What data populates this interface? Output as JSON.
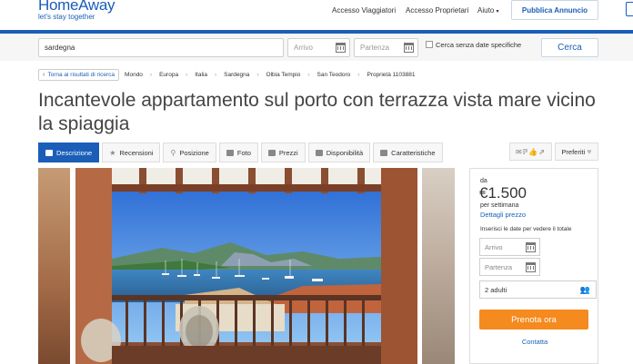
{
  "header": {
    "logo_text": "HomeAway",
    "logo_tagline": "let's stay together",
    "nav": {
      "travelers": "Accesso Viaggiatori",
      "owners": "Accesso Proprietari",
      "help": "Aiuto"
    },
    "publish_button": "Pubblica Annuncio"
  },
  "search": {
    "destination_value": "sardegna",
    "arrival_placeholder": "Arrivo",
    "departure_placeholder": "Partenza",
    "no_dates_label": "Cerca senza date specifiche",
    "search_button": "Cerca"
  },
  "breadcrumb": {
    "back_label": "Torna ai risultati di ricerca",
    "items": [
      "Mondo",
      "Europa",
      "Italia",
      "Sardegna",
      "Olbia Tempio",
      "San Teodoro",
      "Proprietà 1103881"
    ]
  },
  "listing": {
    "title": "Incantevole appartamento sul porto con terrazza vista mare vicino la spiaggia"
  },
  "tabs": [
    {
      "label": "Descrizione",
      "active": true
    },
    {
      "label": "Recensioni",
      "active": false
    },
    {
      "label": "Posizione",
      "active": false
    },
    {
      "label": "Foto",
      "active": false
    },
    {
      "label": "Prezzi",
      "active": false
    },
    {
      "label": "Disponibilità",
      "active": false
    },
    {
      "label": "Caratteristiche",
      "active": false
    }
  ],
  "actions": {
    "favorites_label": "Preferiti"
  },
  "booking": {
    "from_label": "da",
    "price": "€1.500",
    "period": "per settimana",
    "price_details_link": "Dettagli prezzo",
    "dates_hint": "Inserisci le date per vedere il totale",
    "arrival_placeholder": "Arrivo",
    "departure_placeholder": "Partenza",
    "guests_value": "2 adulti",
    "book_button": "Prenota ora",
    "contact_link": "Contatta"
  },
  "colors": {
    "brand_blue": "#1a5eb8",
    "book_orange": "#f58a1f"
  }
}
